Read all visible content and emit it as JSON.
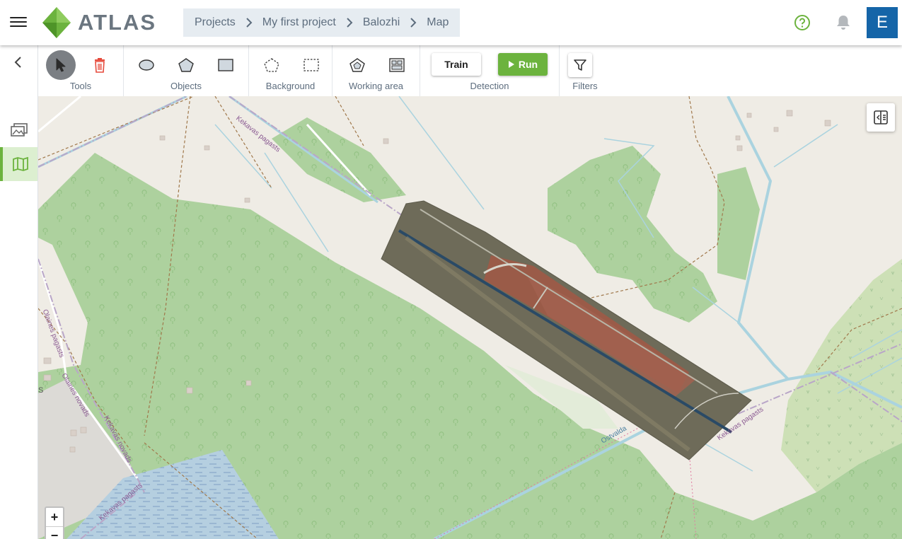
{
  "app": {
    "logo_text": "ATLAS"
  },
  "breadcrumb": [
    "Projects",
    "My first project",
    "Balozhi",
    "Map"
  ],
  "user": {
    "avatar_letter": "E"
  },
  "toolbar": {
    "groups": {
      "tools": "Tools",
      "objects": "Objects",
      "background": "Background",
      "working_area": "Working area",
      "detection": "Detection",
      "filters": "Filters"
    },
    "train_label": "Train",
    "run_label": "Run"
  },
  "map": {
    "labels": {
      "kekavas_top": "Kekavas pagasts",
      "kekavas_right": "Kekavas pagasts",
      "kekavas_bottom": "Kekavas pagasts",
      "kekavas_novads": "Kekavas novads",
      "olaines_pagasts": "Olaines pagasts",
      "olaines_novads": "Olaines novads",
      "ostvalda": "Ostvalda",
      "s": "S"
    },
    "zoom_in": "+",
    "zoom_out": "−"
  },
  "colors": {
    "accent_green": "#6cb33e",
    "avatar_blue": "#1565a8",
    "delete_red": "#e64a3c",
    "forest": "#add19e",
    "land": "#efece5",
    "water": "#aad3df"
  },
  "icons": {
    "menu": "menu-icon",
    "help": "help-icon",
    "bell": "bell-icon",
    "select": "cursor-icon",
    "delete": "trash-icon",
    "ellipse": "ellipse-icon",
    "polygon": "polygon-icon",
    "rectangle": "rectangle-icon",
    "bg_polygon": "dashed-polygon-icon",
    "bg_rect": "dashed-rectangle-icon",
    "area_polygon": "area-polygon-icon",
    "area_grid": "area-grid-icon",
    "run": "play-icon",
    "filter": "filter-icon",
    "collapse": "chevron-left-icon",
    "gallery": "images-icon",
    "map": "map-icon",
    "layers": "layers-panel-icon"
  }
}
